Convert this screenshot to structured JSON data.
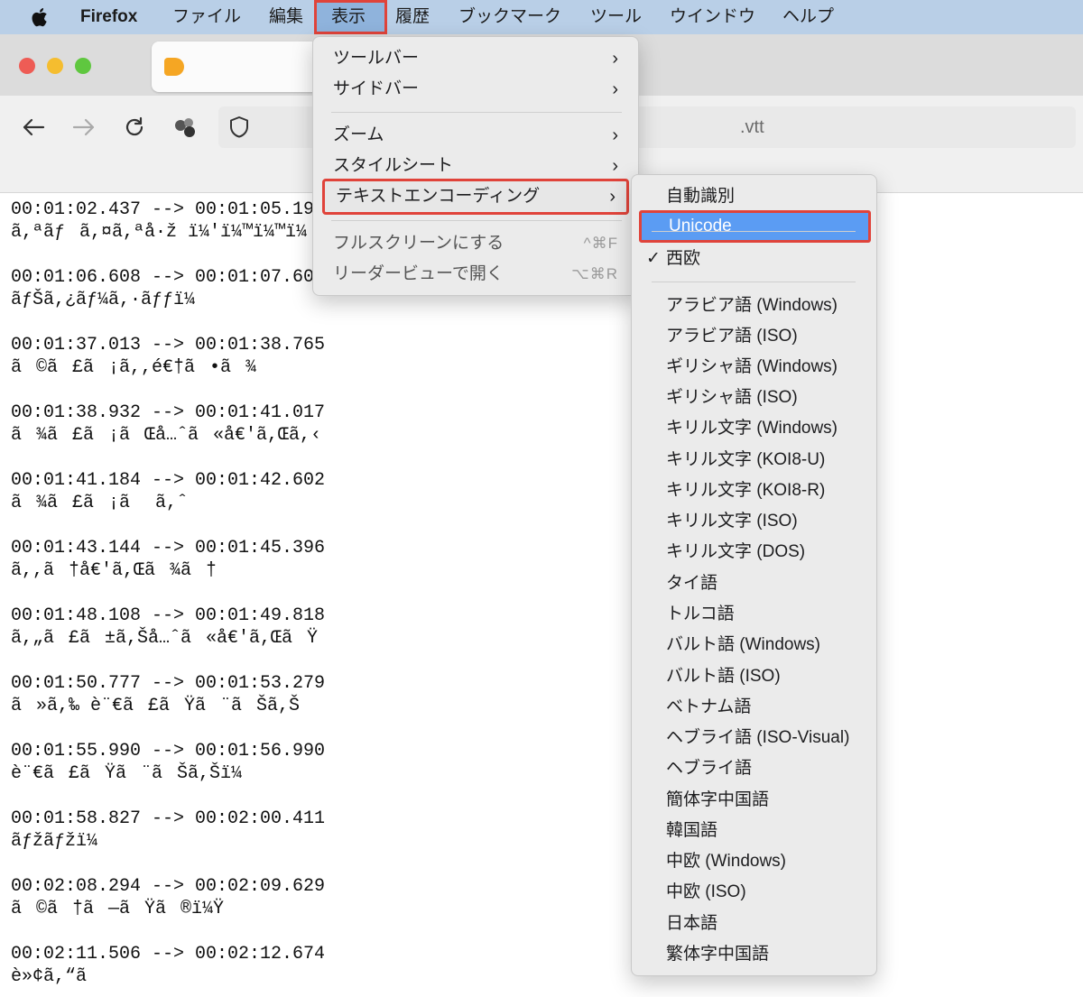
{
  "menubar": {
    "app_name": "Firefox",
    "items": [
      "ファイル",
      "編集",
      "表示",
      "履歴",
      "ブックマーク",
      "ツール",
      "ウインドウ",
      "ヘルプ"
    ]
  },
  "address_bar": {
    "text": ".vtt"
  },
  "view_menu": {
    "items": [
      {
        "label": "ツールバー",
        "submenu": true
      },
      {
        "label": "サイドバー",
        "submenu": true
      },
      {
        "label": "ズーム",
        "submenu": true
      },
      {
        "label": "スタイルシート",
        "submenu": true
      },
      {
        "label": "テキストエンコーディング",
        "submenu": true,
        "highlighted": true
      },
      {
        "label": "フルスクリーンにする",
        "shortcut": "^⌘F"
      },
      {
        "label": "リーダービューで開く",
        "shortcut": "⌥⌘R"
      }
    ]
  },
  "encoding_menu": {
    "items": [
      {
        "label": "自動識別"
      },
      {
        "label": "Unicode",
        "selected": true
      },
      {
        "label": "西欧",
        "checked": true
      },
      {
        "label": "アラビア語 (Windows)"
      },
      {
        "label": "アラビア語 (ISO)"
      },
      {
        "label": "ギリシャ語 (Windows)"
      },
      {
        "label": "ギリシャ語 (ISO)"
      },
      {
        "label": "キリル文字 (Windows)"
      },
      {
        "label": "キリル文字 (KOI8-U)"
      },
      {
        "label": "キリル文字 (KOI8-R)"
      },
      {
        "label": "キリル文字 (ISO)"
      },
      {
        "label": "キリル文字 (DOS)"
      },
      {
        "label": "タイ語"
      },
      {
        "label": "トルコ語"
      },
      {
        "label": "バルト語 (Windows)"
      },
      {
        "label": "バルト語 (ISO)"
      },
      {
        "label": "ベトナム語"
      },
      {
        "label": "ヘブライ語 (ISO-Visual)"
      },
      {
        "label": "ヘブライ語"
      },
      {
        "label": "簡体字中国語"
      },
      {
        "label": "韓国語"
      },
      {
        "label": "中欧 (Windows)"
      },
      {
        "label": "中欧 (ISO)"
      },
      {
        "label": "日本語"
      },
      {
        "label": "繁体字中国語"
      }
    ],
    "check_mark": "✓"
  },
  "page": {
    "cues": [
      {
        "time": "00:01:02.437 --> 00:01:05.19",
        "text": "ã,ªãƒã,¤ã,ªå·ž ï¼'ï¼™ï¼™ï¼"
      },
      {
        "time": "00:01:06.608 --> 00:01:07.60",
        "text": "ãƒŠã,¿ãƒ¼ã,·ãƒƒï¼"
      },
      {
        "time": "00:01:37.013 --> 00:01:38.765",
        "text": "ã©ã£ã¡ã,,é€†ã•ã¾"
      },
      {
        "time": "00:01:38.932 --> 00:01:41.017",
        "text": "ã¾ã£ã¡ãŒå…ˆã«å€'ã,Œã,‹"
      },
      {
        "time": "00:01:41.184 --> 00:01:42.602",
        "text": "ã¾ã£ã¡ã ã,ˆ"
      },
      {
        "time": "00:01:43.144 --> 00:01:45.396",
        "text": "ã,,ã†å€'ã,Œã¾ã†"
      },
      {
        "time": "00:01:48.108 --> 00:01:49.818",
        "text": "ã,„ã£ã±ã,Šå…ˆã«å€'ã,ŒãŸ"
      },
      {
        "time": "00:01:50.777 --> 00:01:53.279",
        "text": "ã»ã,‰ è¨€ã£ãŸã¨ãŠã,Š"
      },
      {
        "time": "00:01:55.990 --> 00:01:56.990",
        "text": "è¨€ã£ãŸã¨ãŠã,Šï¼"
      },
      {
        "time": "00:01:58.827 --> 00:02:00.411",
        "text": "ãƒžãƒžï¼"
      },
      {
        "time": "00:02:08.294 --> 00:02:09.629",
        "text": "ã©ã†ã—ãŸã®ï¼Ÿ"
      },
      {
        "time": "00:02:11.506 --> 00:02:12.674",
        "text": "è»¢ã,“ã"
      }
    ]
  },
  "colors": {
    "menubar_bg": "#b9cfe7",
    "highlight_box": "#e0433a",
    "selection_blue": "#5b9cf3",
    "traffic_red": "#ee5c55",
    "traffic_yellow": "#f5bd2f",
    "traffic_green": "#5fc73f"
  },
  "icons": [
    "apple-icon",
    "back-arrow-icon",
    "forward-arrow-icon",
    "reload-icon",
    "extensions-icon",
    "shield-icon",
    "tab-favicon-icon",
    "chevron-right-icon",
    "checkmark-icon"
  ]
}
